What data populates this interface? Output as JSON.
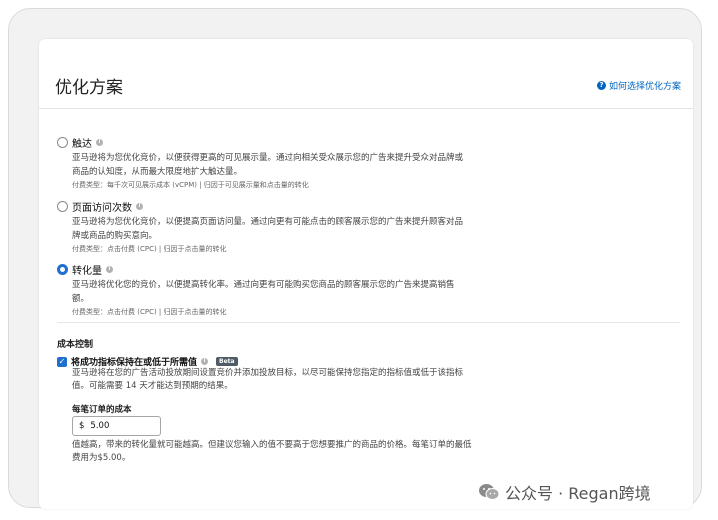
{
  "header": {
    "title": "优化方案",
    "help_link": "如何选择优化方案"
  },
  "options": [
    {
      "label": "触达",
      "selected": false,
      "desc_line1": "亚马逊将为您优化竞价，以便获得更高的可见展示量。通过向相关受众展示您的广告来提升受众对品牌或",
      "desc_line2": "商品的认知度，从而最大限度地扩大触达量。",
      "meta": "付费类型：每千次可见展示成本 (vCPM) | 归因于可见展示量和点击量的转化"
    },
    {
      "label": "页面访问次数",
      "selected": false,
      "desc_line1": "亚马逊将为您优化竞价，以便提高页面访问量。通过向更有可能点击的顾客展示您的广告来提升顾客对品",
      "desc_line2": "牌或商品的购买意向。",
      "meta": "付费类型：点击付费 (CPC) | 归因于点击量的转化"
    },
    {
      "label": "转化量",
      "selected": true,
      "desc_line1": "亚马逊将优化您的竞价，以便提高转化率。通过向更有可能购买您商品的顾客展示您的广告来提高销售",
      "desc_line2": "额。",
      "meta": "付费类型：点击付费 (CPC) | 归因于点击量的转化"
    }
  ],
  "cost_control": {
    "title": "成本控制",
    "checkbox_label": "将成功指标保持在或低于所需值",
    "checked": true,
    "beta": "Beta",
    "desc_line1": "亚马逊将在您的广告活动投放期间设置竞价并添加投放目标，以尽可能保持您指定的指标值或低于该指标",
    "desc_line2": "值。可能需要 14 天才能达到预期的结果。",
    "field_label": "每笔订单的成本",
    "currency": "$",
    "value": "5.00",
    "hint_line1": "值越高，带来的转化量就可能越高。但建议您输入的值不要高于您想要推广的商品的价格。每笔订单的最低",
    "hint_line2": "费用为$5.00。"
  },
  "watermark": {
    "text": "公众号 · Regan跨境"
  },
  "colors": {
    "accent": "#1f6fcf",
    "link": "#0066c0"
  }
}
